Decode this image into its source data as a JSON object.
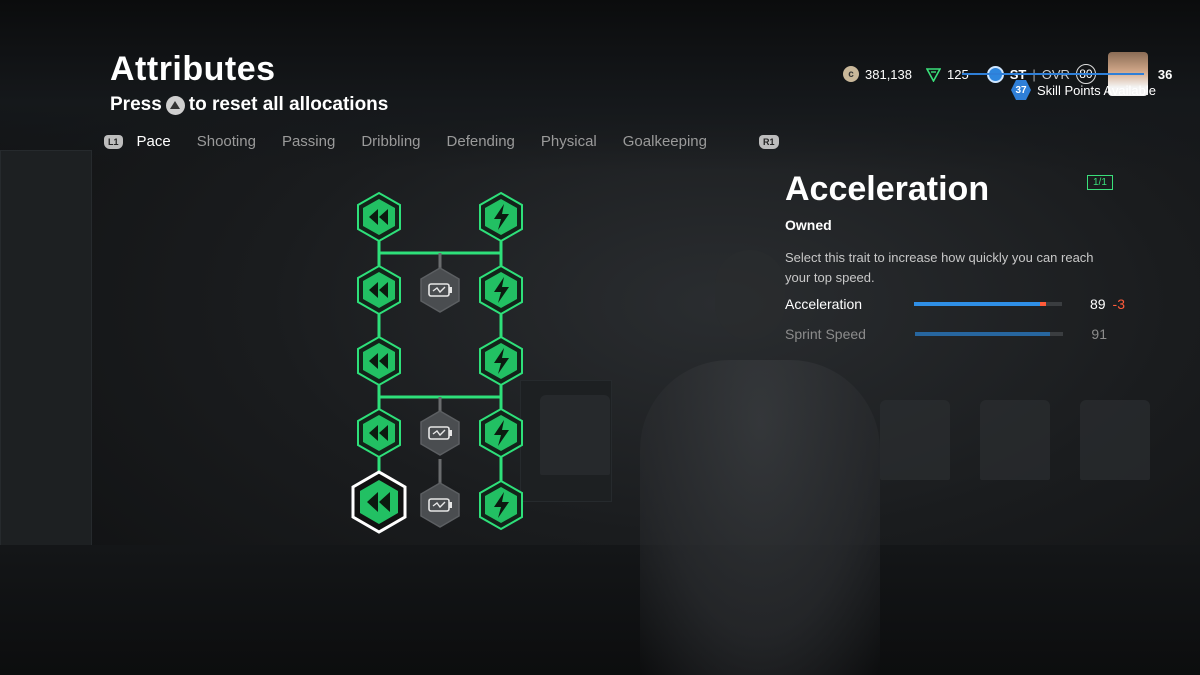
{
  "page": {
    "title": "Attributes",
    "subtitle_press": "Press",
    "subtitle_rest": "to reset all allocations"
  },
  "tabs": {
    "left_bumper": "L1",
    "right_bumper": "R1",
    "items": [
      "Pace",
      "Shooting",
      "Passing",
      "Dribbling",
      "Defending",
      "Physical",
      "Goalkeeping"
    ],
    "active": "Pace"
  },
  "hud": {
    "coins": "381,138",
    "points": "125",
    "position": "ST",
    "ovr_label": "OVR",
    "ovr_value": "80",
    "level": "36",
    "skill_points": "37",
    "skill_points_label": "Skill Points Available"
  },
  "detail": {
    "title": "Acceleration",
    "count": "1/1",
    "status": "Owned",
    "description": "Select this trait to increase how quickly you can reach your top speed.",
    "stats": [
      {
        "name": "Acceleration",
        "value": "89",
        "delta": "-3",
        "fill": 0.89
      },
      {
        "name": "Sprint Speed",
        "value": "91",
        "delta": "",
        "fill": 0.91
      }
    ]
  },
  "tree_nodes": [
    {
      "name": "node-acc-1",
      "type": "acceleration",
      "state": "owned"
    },
    {
      "name": "node-acc-2",
      "type": "acceleration",
      "state": "owned"
    },
    {
      "name": "node-acc-3",
      "type": "acceleration",
      "state": "owned"
    },
    {
      "name": "node-acc-4",
      "type": "acceleration",
      "state": "owned"
    },
    {
      "name": "node-acc-5",
      "type": "acceleration",
      "state": "selected"
    },
    {
      "name": "node-boost-1",
      "type": "battery",
      "state": "locked"
    },
    {
      "name": "node-boost-2",
      "type": "battery",
      "state": "locked"
    },
    {
      "name": "node-boost-3",
      "type": "battery",
      "state": "locked"
    },
    {
      "name": "node-sprint-1",
      "type": "sprint",
      "state": "owned"
    },
    {
      "name": "node-sprint-2",
      "type": "sprint",
      "state": "owned"
    },
    {
      "name": "node-sprint-3",
      "type": "sprint",
      "state": "owned"
    },
    {
      "name": "node-sprint-4",
      "type": "sprint",
      "state": "owned"
    },
    {
      "name": "node-sprint-5",
      "type": "sprint",
      "state": "owned"
    }
  ],
  "colors": {
    "accent_green": "#3adf7a",
    "node_green": "#1f9b52",
    "locked_gray": "#4a4d50",
    "stat_blue": "#2f8fe6",
    "delta_red": "#ff5b3a"
  }
}
